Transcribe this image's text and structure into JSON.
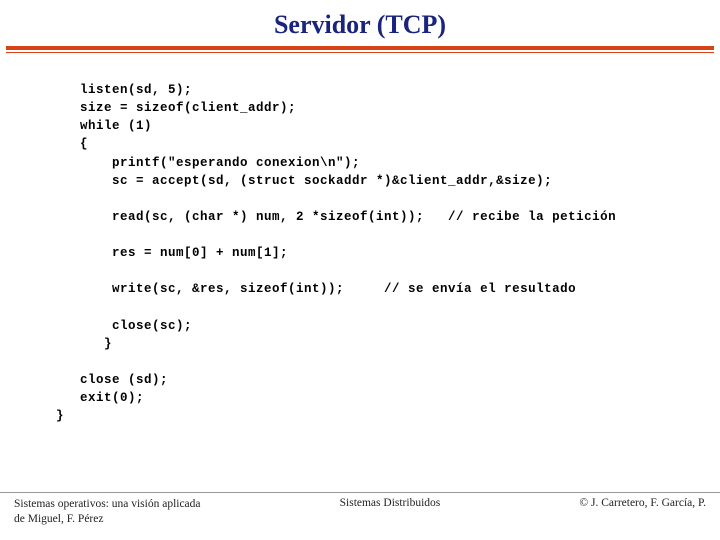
{
  "title": "Servidor (TCP)",
  "code": "   listen(sd, 5);\n   size = sizeof(client_addr);\n   while (1)\n   {\n       printf(\"esperando conexion\\n\");\n       sc = accept(sd, (struct sockaddr *)&client_addr,&size);\n\n       read(sc, (char *) num, 2 *sizeof(int));   // recibe la petición\n\n       res = num[0] + num[1];\n\n       write(sc, &res, sizeof(int));     // se envía el resultado\n\n       close(sc);\n      }\n\n   close (sd);\n   exit(0);\n}",
  "footer": {
    "left_line1": "Sistemas operativos: una visión aplicada",
    "left_line2": "de Miguel, F. Pérez",
    "center": "Sistemas Distribuidos",
    "right": "© J. Carretero, F. García, P."
  }
}
